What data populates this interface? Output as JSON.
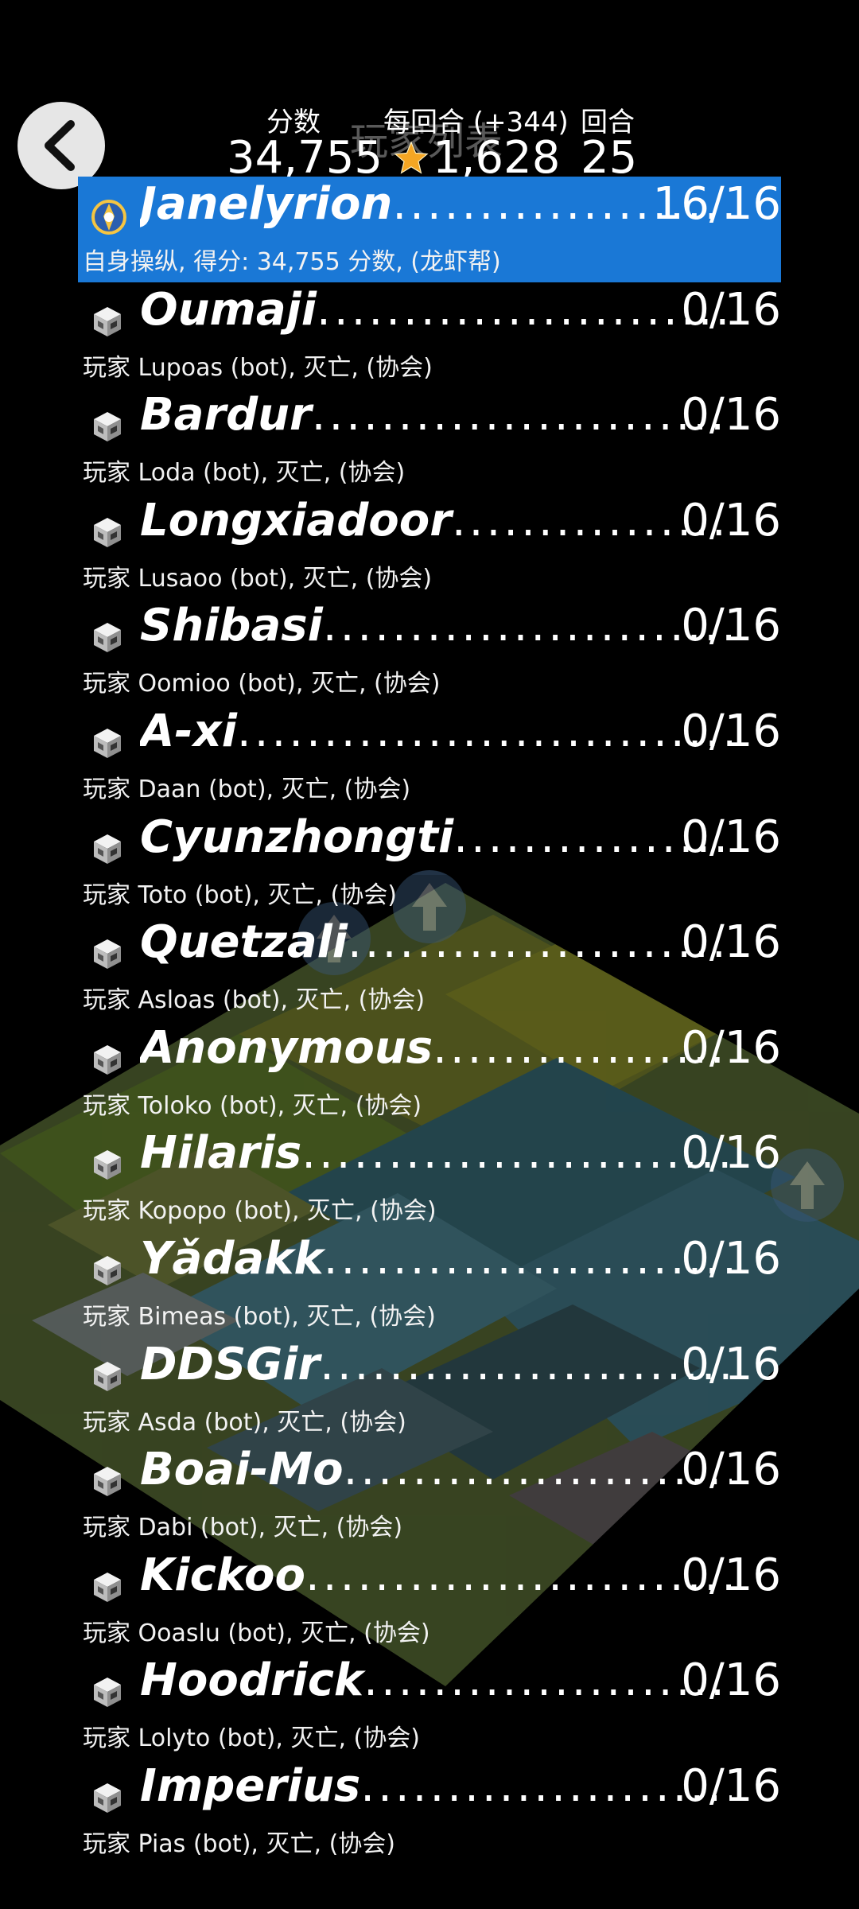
{
  "header": {
    "title": "玩家列表",
    "score_label": "分数",
    "score_value": "34,755",
    "per_turn_label": "每回合 (+344)",
    "per_turn_value": "1,628",
    "turn_label": "回合",
    "turn_value": "25"
  },
  "players": [
    {
      "name": "Janelyrion",
      "score": "16/16",
      "subtitle": "自身操纵, 得分: 34,755 分数, (龙虾帮)",
      "highlight": true,
      "icon": "tribe-emblem-icon"
    },
    {
      "name": "Oumaji",
      "score": "0/16",
      "subtitle": "玩家 Lupoas (bot), 灭亡, (协会)",
      "highlight": false,
      "icon": "bot-cube-icon"
    },
    {
      "name": "Bardur",
      "score": "0/16",
      "subtitle": "玩家 Loda (bot), 灭亡, (协会)",
      "highlight": false,
      "icon": "bot-cube-icon"
    },
    {
      "name": "Longxiadoor",
      "score": "0/16",
      "subtitle": "玩家 Lusaoo (bot), 灭亡, (协会)",
      "highlight": false,
      "icon": "bot-cube-icon"
    },
    {
      "name": "Shibasi",
      "score": "0/16",
      "subtitle": "玩家 Oomioo (bot), 灭亡, (协会)",
      "highlight": false,
      "icon": "bot-cube-icon"
    },
    {
      "name": "A-xi",
      "score": "0/16",
      "subtitle": "玩家 Daan (bot), 灭亡, (协会)",
      "highlight": false,
      "icon": "bot-cube-icon"
    },
    {
      "name": "Cyunzhongti",
      "score": "0/16",
      "subtitle": "玩家 Toto (bot), 灭亡, (协会)",
      "highlight": false,
      "icon": "bot-cube-icon"
    },
    {
      "name": "Quetzali",
      "score": "0/16",
      "subtitle": "玩家 Asloas (bot), 灭亡, (协会)",
      "highlight": false,
      "icon": "bot-cube-icon"
    },
    {
      "name": "Anonymous",
      "score": "0/16",
      "subtitle": "玩家 Toloko (bot), 灭亡, (协会)",
      "highlight": false,
      "icon": "bot-cube-icon"
    },
    {
      "name": "Hilaris",
      "score": "0/16",
      "subtitle": "玩家 Kopopo (bot), 灭亡, (协会)",
      "highlight": false,
      "icon": "bot-cube-icon"
    },
    {
      "name": "Yǎdakk",
      "score": "0/16",
      "subtitle": "玩家 Bimeas (bot), 灭亡, (协会)",
      "highlight": false,
      "icon": "bot-cube-icon"
    },
    {
      "name": "DDSGir",
      "score": "0/16",
      "subtitle": "玩家 Asda (bot), 灭亡, (协会)",
      "highlight": false,
      "icon": "bot-cube-icon"
    },
    {
      "name": "Boai-Mo",
      "score": "0/16",
      "subtitle": "玩家 Dabi (bot), 灭亡, (协会)",
      "highlight": false,
      "icon": "bot-cube-icon"
    },
    {
      "name": "Kickoo",
      "score": "0/16",
      "subtitle": "玩家 Ooaslu (bot), 灭亡, (协会)",
      "highlight": false,
      "icon": "bot-cube-icon"
    },
    {
      "name": "Hoodrick",
      "score": "0/16",
      "subtitle": "玩家 Lolyto (bot), 灭亡, (协会)",
      "highlight": false,
      "icon": "bot-cube-icon"
    },
    {
      "name": "Imperius",
      "score": "0/16",
      "subtitle": "玩家 Pias (bot), 灭亡, (协会)",
      "highlight": false,
      "icon": "bot-cube-icon"
    }
  ],
  "colors": {
    "highlight": "#1a78d6",
    "background": "#000000",
    "star": "#f5a623"
  }
}
